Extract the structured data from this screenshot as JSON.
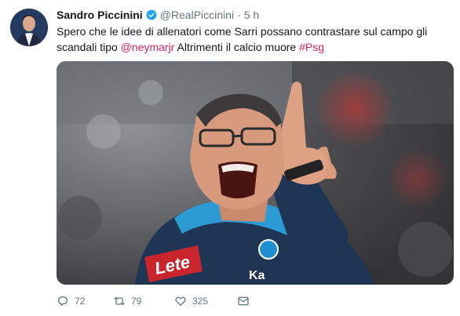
{
  "user": {
    "name": "Sandro Piccinini",
    "handle": "@RealPiccinini",
    "separator": "·",
    "time": "5 h"
  },
  "tweet": {
    "text_1": "Spero che le idee di allenatori come Sarri possano contrastare sul campo gli scandali tipo ",
    "mention": "@neymarjr",
    "text_2": " Altrimenti il calcio muore ",
    "hashtag": "#Psg"
  },
  "media": {
    "jersey_text_1": "Lete",
    "jersey_text_2": "Ka"
  },
  "actions": {
    "replies": "72",
    "retweets": "79",
    "likes": "325"
  },
  "colors": {
    "accent": "#e0245e",
    "verified": "#1da1f2",
    "muted": "#657786"
  },
  "icons": [
    "verified-badge-icon",
    "reply-icon",
    "retweet-icon",
    "like-icon",
    "direct-message-icon"
  ]
}
